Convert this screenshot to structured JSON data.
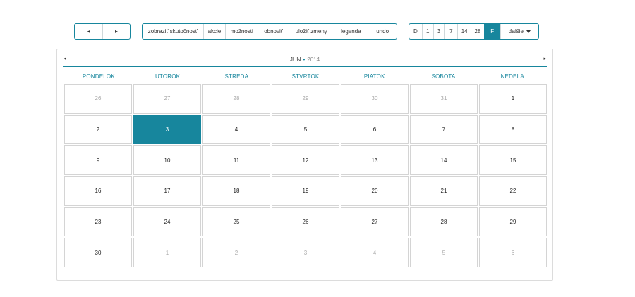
{
  "nav": {
    "prev_icon": "◂",
    "next_icon": "▸"
  },
  "actions": [
    {
      "label": "zobraziť skutočnosť"
    },
    {
      "label": "akcie"
    },
    {
      "label": "možnosti"
    },
    {
      "label": "obnoviť"
    },
    {
      "label": "uložiť zmeny"
    },
    {
      "label": "legenda"
    },
    {
      "label": "undo"
    }
  ],
  "views": {
    "buttons": [
      "D",
      "1",
      "3",
      "7",
      "14",
      "28",
      "F"
    ],
    "active": "F",
    "more_label": "ďalšie"
  },
  "calendar": {
    "month": "JUN",
    "separator": "•",
    "year": "2014",
    "weekdays": [
      "PONDELOK",
      "UTOROK",
      "STREDA",
      "STVRTOK",
      "PIATOK",
      "SOBOTA",
      "NEDELA"
    ],
    "days": [
      {
        "d": "26",
        "other": true
      },
      {
        "d": "27",
        "other": true
      },
      {
        "d": "28",
        "other": true
      },
      {
        "d": "29",
        "other": true
      },
      {
        "d": "30",
        "other": true
      },
      {
        "d": "31",
        "other": true
      },
      {
        "d": "1"
      },
      {
        "d": "2"
      },
      {
        "d": "3",
        "selected": true
      },
      {
        "d": "4"
      },
      {
        "d": "5"
      },
      {
        "d": "6"
      },
      {
        "d": "7"
      },
      {
        "d": "8"
      },
      {
        "d": "9"
      },
      {
        "d": "10"
      },
      {
        "d": "11"
      },
      {
        "d": "12"
      },
      {
        "d": "13"
      },
      {
        "d": "14"
      },
      {
        "d": "15"
      },
      {
        "d": "16"
      },
      {
        "d": "17"
      },
      {
        "d": "18"
      },
      {
        "d": "19"
      },
      {
        "d": "20"
      },
      {
        "d": "21"
      },
      {
        "d": "22"
      },
      {
        "d": "23"
      },
      {
        "d": "24"
      },
      {
        "d": "25"
      },
      {
        "d": "26"
      },
      {
        "d": "27"
      },
      {
        "d": "28"
      },
      {
        "d": "29"
      },
      {
        "d": "30"
      },
      {
        "d": "1",
        "other": true
      },
      {
        "d": "2",
        "other": true
      },
      {
        "d": "3",
        "other": true
      },
      {
        "d": "4",
        "other": true
      },
      {
        "d": "5",
        "other": true
      },
      {
        "d": "6",
        "other": true
      }
    ]
  },
  "colors": {
    "accent": "#17869d",
    "other_month_text": "#aaaaaa",
    "border": "#d4d4d4"
  }
}
